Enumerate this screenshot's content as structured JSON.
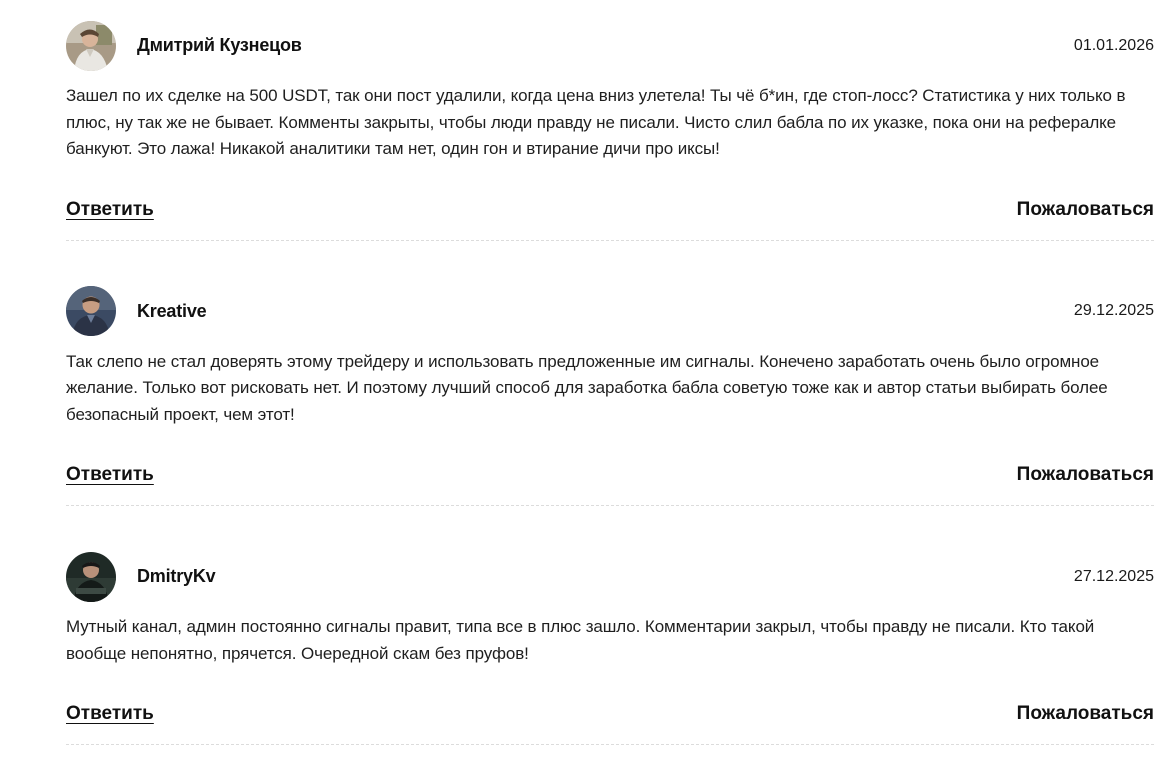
{
  "comments": [
    {
      "author": "Дмитрий Кузнецов",
      "date": "01.01.2026",
      "text": "Зашел по их сделке на 500 USDT, так они пост удалили, когда цена вниз улетела! Ты чё б*ин, где стоп-лосс? Статистика у них только в плюс, ну так же не бывает. Комменты закрыты, чтобы люди правду не писали. Чисто слил бабла по их указке, пока они на рефералке банкуют. Это лажа! Никакой аналитики там нет, один гон и втирание дичи про иксы!",
      "reply_label": "Ответить",
      "complain_label": "Пожаловаться",
      "avatar_icon": "user-photo-avatar"
    },
    {
      "author": "Kreative",
      "date": "29.12.2025",
      "text": "Так слепо не стал доверять этому трейдеру и использовать предложенные им сигналы. Конечено заработать очень было огромное желание. Только вот рисковать нет. И поэтому лучший способ для заработка бабла советую тоже как и автор статьи выбирать более безопасный проект, чем этот!",
      "reply_label": "Ответить",
      "complain_label": "Пожаловаться",
      "avatar_icon": "user-photo-avatar"
    },
    {
      "author": "DmitryKv",
      "date": "27.12.2025",
      "text": "Мутный канал, админ постоянно сигналы правит, типа все в плюс зашло. Комментарии закрыл, чтобы правду не писали. Кто такой вообще непонятно, прячется. Очередной скам без пруфов!",
      "reply_label": "Ответить",
      "complain_label": "Пожаловаться",
      "avatar_icon": "user-photo-avatar"
    }
  ]
}
